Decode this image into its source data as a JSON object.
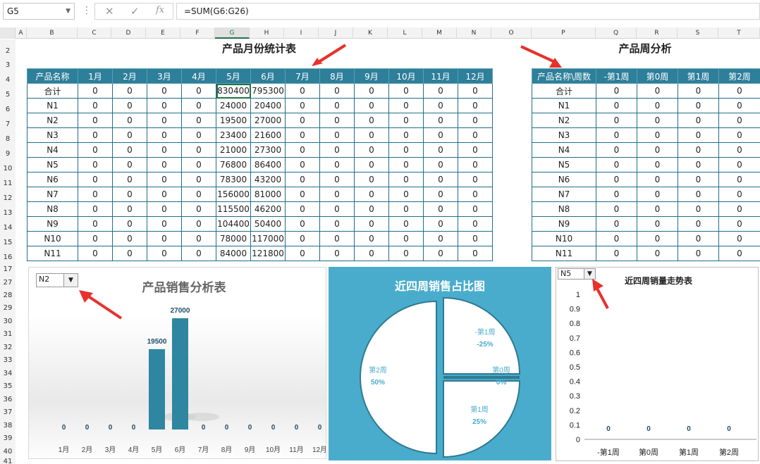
{
  "formula_bar": {
    "name_box": "G5",
    "formula": "=SUM(G6:G26)",
    "cancel_icon": "✕",
    "enter_icon": "✓",
    "fx_label": "fx"
  },
  "col_headers": [
    "A",
    "B",
    "C",
    "D",
    "E",
    "F",
    "G",
    "H",
    "I",
    "J",
    "K",
    "L",
    "M",
    "N",
    "O",
    "P",
    "Q",
    "R",
    "S",
    "T"
  ],
  "row_headers": [
    "2",
    "3",
    "4",
    "5",
    "6",
    "7",
    "8",
    "9",
    "10",
    "11",
    "12",
    "13",
    "14",
    "15",
    "16",
    "17",
    "27",
    "28",
    "29",
    "30",
    "31",
    "32",
    "33",
    "34",
    "35",
    "36",
    "37",
    "38",
    "39",
    "40",
    "41"
  ],
  "monthly": {
    "title": "产品月份统计表",
    "headers": [
      "产品名称",
      "1月",
      "2月",
      "3月",
      "4月",
      "5月",
      "6月",
      "7月",
      "8月",
      "9月",
      "10月",
      "11月",
      "12月"
    ],
    "rows": [
      [
        "合计",
        "0",
        "0",
        "0",
        "0",
        "830400",
        "795300",
        "0",
        "0",
        "0",
        "0",
        "0",
        "0"
      ],
      [
        "N1",
        "0",
        "0",
        "0",
        "0",
        "24000",
        "20400",
        "0",
        "0",
        "0",
        "0",
        "0",
        "0"
      ],
      [
        "N2",
        "0",
        "0",
        "0",
        "0",
        "19500",
        "27000",
        "0",
        "0",
        "0",
        "0",
        "0",
        "0"
      ],
      [
        "N3",
        "0",
        "0",
        "0",
        "0",
        "23400",
        "21600",
        "0",
        "0",
        "0",
        "0",
        "0",
        "0"
      ],
      [
        "N4",
        "0",
        "0",
        "0",
        "0",
        "21000",
        "27300",
        "0",
        "0",
        "0",
        "0",
        "0",
        "0"
      ],
      [
        "N5",
        "0",
        "0",
        "0",
        "0",
        "76800",
        "86400",
        "0",
        "0",
        "0",
        "0",
        "0",
        "0"
      ],
      [
        "N6",
        "0",
        "0",
        "0",
        "0",
        "78300",
        "43200",
        "0",
        "0",
        "0",
        "0",
        "0",
        "0"
      ],
      [
        "N7",
        "0",
        "0",
        "0",
        "0",
        "156000",
        "81000",
        "0",
        "0",
        "0",
        "0",
        "0",
        "0"
      ],
      [
        "N8",
        "0",
        "0",
        "0",
        "0",
        "115500",
        "46200",
        "0",
        "0",
        "0",
        "0",
        "0",
        "0"
      ],
      [
        "N9",
        "0",
        "0",
        "0",
        "0",
        "104400",
        "50400",
        "0",
        "0",
        "0",
        "0",
        "0",
        "0"
      ],
      [
        "N10",
        "0",
        "0",
        "0",
        "0",
        "78000",
        "117000",
        "0",
        "0",
        "0",
        "0",
        "0",
        "0"
      ],
      [
        "N11",
        "0",
        "0",
        "0",
        "0",
        "84000",
        "121800",
        "0",
        "0",
        "0",
        "0",
        "0",
        "0"
      ]
    ]
  },
  "weekly": {
    "title": "产品周分析",
    "headers": [
      "产品名称\\周数",
      "-第1周",
      "第0周",
      "第1周",
      "第2周"
    ],
    "rows": [
      [
        "合计",
        "0",
        "0",
        "0",
        "0"
      ],
      [
        "N1",
        "0",
        "0",
        "0",
        "0"
      ],
      [
        "N2",
        "0",
        "0",
        "0",
        "0"
      ],
      [
        "N3",
        "0",
        "0",
        "0",
        "0"
      ],
      [
        "N4",
        "0",
        "0",
        "0",
        "0"
      ],
      [
        "N5",
        "0",
        "0",
        "0",
        "0"
      ],
      [
        "N6",
        "0",
        "0",
        "0",
        "0"
      ],
      [
        "N7",
        "0",
        "0",
        "0",
        "0"
      ],
      [
        "N8",
        "0",
        "0",
        "0",
        "0"
      ],
      [
        "N9",
        "0",
        "0",
        "0",
        "0"
      ],
      [
        "N10",
        "0",
        "0",
        "0",
        "0"
      ],
      [
        "N11",
        "0",
        "0",
        "0",
        "0"
      ]
    ]
  },
  "chart_data": [
    {
      "type": "bar",
      "title": "产品销售分析表",
      "selector": "N2",
      "categories": [
        "1月",
        "2月",
        "3月",
        "4月",
        "5月",
        "6月",
        "7月",
        "8月",
        "9月",
        "10月",
        "11月",
        "12月"
      ],
      "values": [
        0,
        0,
        0,
        0,
        19500,
        27000,
        0,
        0,
        0,
        0,
        0,
        0
      ],
      "value_labels": [
        "0",
        "0",
        "0",
        "0",
        "19500",
        "27000",
        "0",
        "0",
        "0",
        "0",
        "0",
        "0"
      ],
      "ylim": [
        0,
        27000
      ],
      "bar_color": "#2e86a0",
      "grid": false
    },
    {
      "type": "pie",
      "title": "近四周销售占比图",
      "background": "#4aaccc",
      "slices": [
        {
          "label": "-第1周",
          "pct_label": "-25%",
          "value": -25
        },
        {
          "label": "第0周",
          "pct_label": "0%",
          "value": 0
        },
        {
          "label": "第1周",
          "pct_label": "25%",
          "value": 25
        },
        {
          "label": "第2周",
          "pct_label": "50%",
          "value": 50
        }
      ]
    },
    {
      "type": "line",
      "title": "近四周销量走势表",
      "selector": "N5",
      "categories": [
        "-第1周",
        "第0周",
        "第1周",
        "第2周"
      ],
      "values": [
        0,
        0,
        0,
        0
      ],
      "value_labels": [
        "0",
        "0",
        "0",
        "0"
      ],
      "yticks": [
        "1",
        "0.9",
        "0.8",
        "0.7",
        "0.6",
        "0.5",
        "0.4",
        "0.3",
        "0.2",
        "0.1",
        "0"
      ],
      "ylim": [
        0,
        1
      ],
      "grid": false
    }
  ]
}
